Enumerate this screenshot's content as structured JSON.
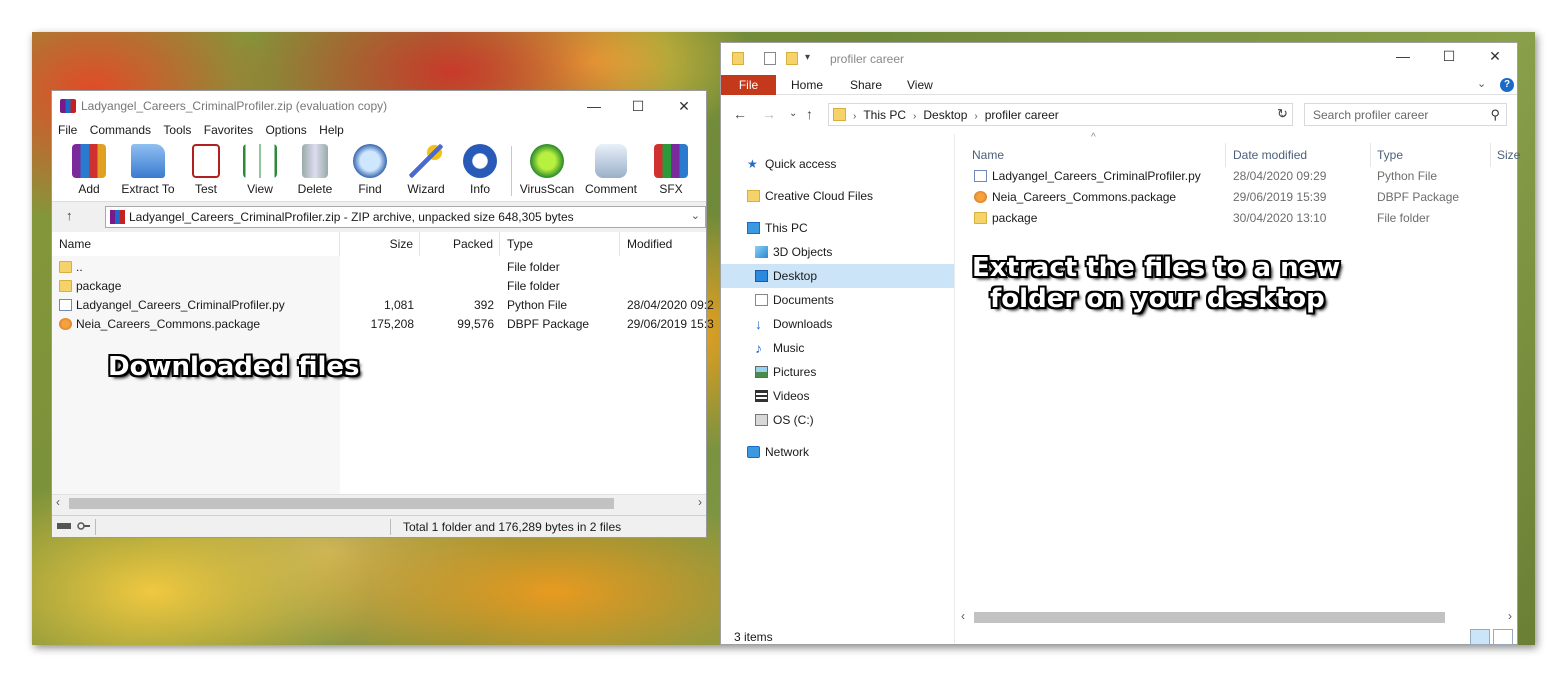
{
  "rar": {
    "title": "Ladyangel_Careers_CriminalProfiler.zip (evaluation copy)",
    "window_controls": {
      "minimize": "—",
      "maximize": "☐",
      "close": "✕"
    },
    "menu": [
      "File",
      "Commands",
      "Tools",
      "Favorites",
      "Options",
      "Help"
    ],
    "toolbar": [
      {
        "label": "Add",
        "icon": "archive-books-icon"
      },
      {
        "label": "Extract To",
        "icon": "extract-folder-icon"
      },
      {
        "label": "Test",
        "icon": "test-clipboard-icon"
      },
      {
        "label": "View",
        "icon": "view-book-icon"
      },
      {
        "label": "Delete",
        "icon": "delete-trash-icon"
      },
      {
        "label": "Find",
        "icon": "find-magnifier-icon"
      },
      {
        "label": "Wizard",
        "icon": "wizard-wand-icon"
      },
      {
        "label": "Info",
        "icon": "info-icon"
      },
      {
        "label": "VirusScan",
        "icon": "virusscan-bug-icon"
      },
      {
        "label": "Comment",
        "icon": "comment-bubble-icon"
      },
      {
        "label": "SFX",
        "icon": "sfx-archive-icon"
      }
    ],
    "address": "Ladyangel_Careers_CriminalProfiler.zip - ZIP archive, unpacked size 648,305 bytes",
    "columns": {
      "name": "Name",
      "size": "Size",
      "packed": "Packed",
      "type": "Type",
      "modified": "Modified"
    },
    "rows": [
      {
        "name": "..",
        "size": "",
        "packed": "",
        "type": "File folder",
        "modified": "",
        "icon": "folder-icon"
      },
      {
        "name": "package",
        "size": "",
        "packed": "",
        "type": "File folder",
        "modified": "",
        "icon": "folder-icon"
      },
      {
        "name": "Ladyangel_Careers_CriminalProfiler.py",
        "size": "1,081",
        "packed": "392",
        "type": "Python File",
        "modified": "28/04/2020 09:2",
        "icon": "python-file-icon"
      },
      {
        "name": "Neia_Careers_Commons.package",
        "size": "175,208",
        "packed": "99,576",
        "type": "DBPF Package",
        "modified": "29/06/2019 15:3",
        "icon": "package-file-icon"
      }
    ],
    "status": "Total 1 folder and 176,289 bytes in 2 files"
  },
  "explorer": {
    "title": "profiler career",
    "window_controls": {
      "minimize": "—",
      "maximize": "☐",
      "close": "✕"
    },
    "ribbon": {
      "file": "File",
      "tabs": [
        "Home",
        "Share",
        "View"
      ]
    },
    "breadcrumb": [
      "This PC",
      "Desktop",
      "profiler career"
    ],
    "search_placeholder": "Search profiler career",
    "nav": [
      {
        "label": "Quick access",
        "icon": "star-icon",
        "indent": 0
      },
      {
        "label": "Creative Cloud Files",
        "icon": "creative-cloud-folder-icon",
        "indent": 0
      },
      {
        "label": "This PC",
        "icon": "computer-icon",
        "indent": 0
      },
      {
        "label": "3D Objects",
        "icon": "cube-icon",
        "indent": 1
      },
      {
        "label": "Desktop",
        "icon": "desktop-icon",
        "indent": 1,
        "selected": true
      },
      {
        "label": "Documents",
        "icon": "documents-icon",
        "indent": 1
      },
      {
        "label": "Downloads",
        "icon": "download-arrow-icon",
        "indent": 1
      },
      {
        "label": "Music",
        "icon": "music-note-icon",
        "indent": 1
      },
      {
        "label": "Pictures",
        "icon": "pictures-icon",
        "indent": 1
      },
      {
        "label": "Videos",
        "icon": "videos-icon",
        "indent": 1
      },
      {
        "label": "OS (C:)",
        "icon": "drive-icon",
        "indent": 1
      },
      {
        "label": "Network",
        "icon": "network-icon",
        "indent": 0
      }
    ],
    "columns": {
      "name": "Name",
      "date": "Date modified",
      "type": "Type",
      "size": "Size"
    },
    "rows": [
      {
        "name": "Ladyangel_Careers_CriminalProfiler.py",
        "date": "28/04/2020 09:29",
        "type": "Python File",
        "icon": "python-file-icon"
      },
      {
        "name": "Neia_Careers_Commons.package",
        "date": "29/06/2019 15:39",
        "type": "DBPF Package",
        "icon": "package-file-icon"
      },
      {
        "name": "package",
        "date": "30/04/2020 13:10",
        "type": "File folder",
        "icon": "folder-icon"
      }
    ],
    "status": "3 items"
  },
  "annotations": {
    "downloaded": "Downloaded files",
    "extract_line1": "Extract the files to a new",
    "extract_line2": "folder on your desktop"
  },
  "colors": {
    "explorer_file_tab": "#c4391c",
    "nav_selected": "#cce4f7"
  }
}
